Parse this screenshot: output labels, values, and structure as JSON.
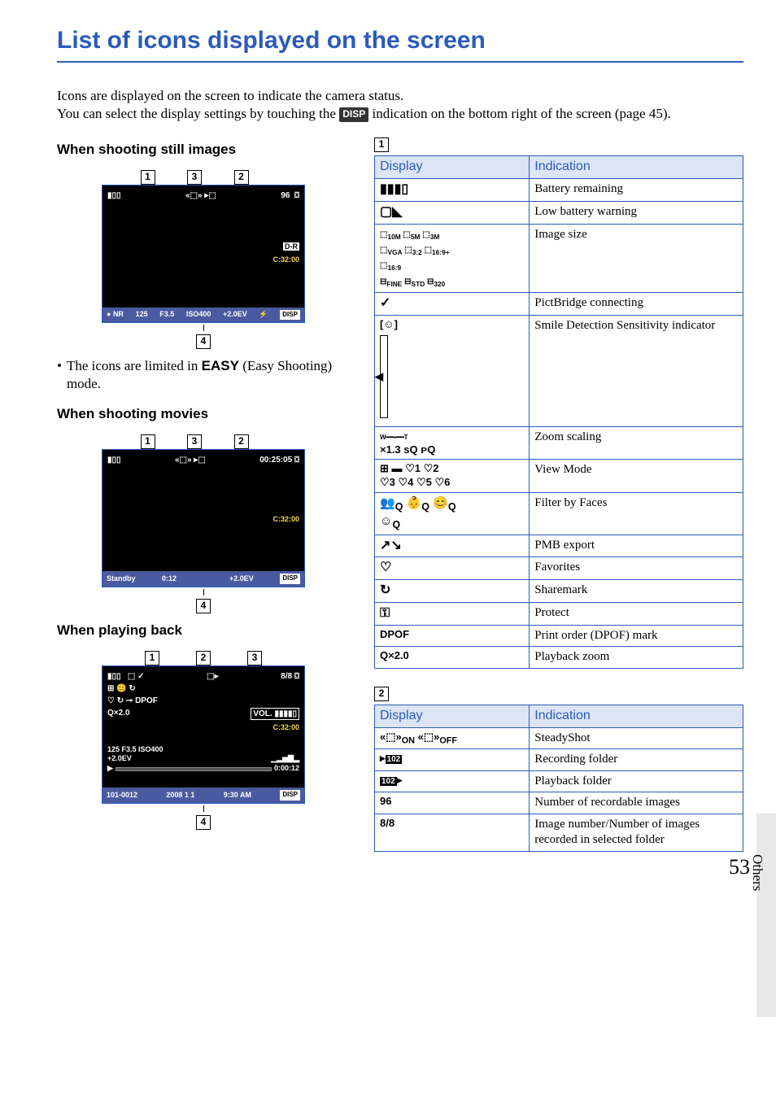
{
  "page_title": "List of icons displayed on the screen",
  "intro_line1": "Icons are displayed on the screen to indicate the camera status.",
  "intro_line2a": "You can select the display settings by touching the ",
  "intro_disp_chip": "DISP",
  "intro_line2b": " indication on the bottom right of the screen (page 45).",
  "sections": {
    "still": "When shooting still images",
    "movie": "When shooting movies",
    "play": "When playing back"
  },
  "callouts": [
    "1",
    "2",
    "3",
    "4"
  ],
  "still_screen": {
    "top_right_num": "96",
    "isosym": "ISO400",
    "shutter": "125",
    "fnum": "F3.5",
    "ev": "+2.0EV",
    "err": "C:32:00",
    "disp": "DISP"
  },
  "note_text_a": "The icons are limited in ",
  "note_easy": "EASY",
  "note_text_b": " (Easy Shooting) mode.",
  "movie_screen": {
    "time": "00:25:05",
    "err": "C:32:00",
    "standby": "Standby",
    "elapsed": "0:12",
    "ev": "+2.0EV",
    "disp": "DISP"
  },
  "play_screen": {
    "counter": "8/8",
    "vol": "VOL.",
    "err": "C:32:00",
    "line": "125   F3.5   ISO400",
    "ev": "+2.0EV",
    "dur": "0:00:12",
    "folder": "101-0012",
    "date": "2008 1 1",
    "timeofday": "9:30 AM",
    "zoom": "×2.0",
    "dpof": "DPOF",
    "disp": "DISP"
  },
  "table1": {
    "h1": "Display",
    "h2": "Indication",
    "rows": [
      {
        "disp_icon": "battery-icon",
        "disp_text": "",
        "ind": "Battery remaining"
      },
      {
        "disp_icon": "battery-low-icon",
        "disp_text": "",
        "ind": "Low battery warning"
      },
      {
        "disp_icon": "size-icons",
        "disp_text": "10M 5M 3M VGA 3:2 16:9+ 16:9 FINE STD 320",
        "ind": "Image size"
      },
      {
        "disp_icon": "pictbridge-icon",
        "disp_text": "",
        "ind": "PictBridge connecting"
      },
      {
        "disp_icon": "smile-gauge-icon",
        "disp_text": "",
        "ind": "Smile Detection Sensitivity indicator"
      },
      {
        "disp_icon": "zoom-icon",
        "disp_text": "×1.3 sQ pQ",
        "ind": "Zoom scaling"
      },
      {
        "disp_icon": "viewmode-icon",
        "disp_text": "♡1 ♡2 ♡3 ♡4 ♡5 ♡6",
        "ind": "View Mode"
      },
      {
        "disp_icon": "faces-icon",
        "disp_text": "",
        "ind": "Filter by Faces"
      },
      {
        "disp_icon": "pmb-icon",
        "disp_text": "",
        "ind": "PMB export"
      },
      {
        "disp_icon": "heart-icon",
        "disp_text": "",
        "ind": "Favorites"
      },
      {
        "disp_icon": "sharemark-icon",
        "disp_text": "",
        "ind": "Sharemark"
      },
      {
        "disp_icon": "key-icon",
        "disp_text": "",
        "ind": "Protect"
      },
      {
        "disp_icon": "dpof-icon",
        "disp_text": "DPOF",
        "ind": "Print order (DPOF) mark"
      },
      {
        "disp_icon": "magnifier-icon",
        "disp_text": "Q×2.0",
        "ind": "Playback zoom"
      }
    ]
  },
  "table2": {
    "h1": "Display",
    "h2": "Indication",
    "rows": [
      {
        "disp_icon": "steadyshot-icon",
        "disp_text": "ON  OFF",
        "ind": "SteadyShot"
      },
      {
        "disp_icon": "rec-folder-icon",
        "disp_text": "",
        "ind": "Recording folder"
      },
      {
        "disp_icon": "play-folder-icon",
        "disp_text": "",
        "ind": "Playback folder"
      },
      {
        "disp_icon": "",
        "disp_text": "96",
        "ind": "Number of recordable images"
      },
      {
        "disp_icon": "",
        "disp_text": "8/8",
        "ind": "Image number/Number of images recorded in selected folder"
      }
    ]
  },
  "sidebar_label": "Others",
  "page_number": "53"
}
